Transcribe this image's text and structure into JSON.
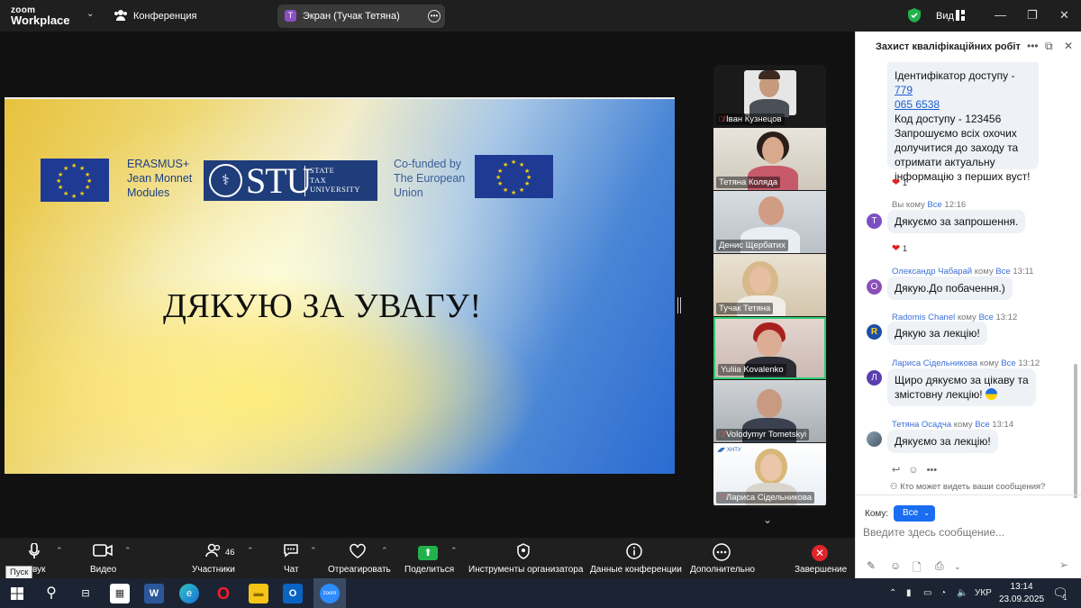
{
  "topbar": {
    "logo_top": "zoom",
    "logo_bottom": "Workplace",
    "conference_label": "Конференция",
    "share_badge": "T",
    "share_title": "Экран (Тучак Тетяна)",
    "view_label": "Вид"
  },
  "slide": {
    "erasmus_line1": "ERASMUS+",
    "erasmus_line2": "Jean Monnet",
    "erasmus_line3": "Modules",
    "stu_big": "STU",
    "stu_small_1": "STATE",
    "stu_small_2": "TAX",
    "stu_small_3": "UNIVERSITY",
    "cofunded_1": "Co-funded by",
    "cofunded_2": "The European",
    "cofunded_3": "Union",
    "title": "ДЯКУЮ ЗА УВАГУ!"
  },
  "participants": [
    {
      "name": "Іван Кузнецов",
      "muted": true
    },
    {
      "name": "Тетяна Коляда",
      "muted": false
    },
    {
      "name": "Денис Щербатих",
      "muted": false
    },
    {
      "name": "Тучак Тетяна",
      "muted": false
    },
    {
      "name": "Yuliia Kovalenko",
      "muted": false
    },
    {
      "name": "Volodymyr Tometskyi",
      "muted": true
    },
    {
      "name": "Лариса Сідельникова",
      "muted": true
    }
  ],
  "chat": {
    "title": "Захист кваліфікаційних робіт",
    "msg0_line_access_id": "Ідентифікатор доступу - ",
    "msg0_id_link_1": "779",
    "msg0_id_link_2": "065 6538",
    "msg0_code": "Код доступу - 123456",
    "msg0_invite_1": "Запрошуємо всіх охочих",
    "msg0_invite_2": "долучитися до заходу та",
    "msg0_invite_3": "отримати актуальну",
    "msg0_invite_4": "інформацію з перших вуст!",
    "reaction_count": "1",
    "messages": [
      {
        "avatar": "T",
        "avatar_color": "#7b4fc4",
        "who": "Вы",
        "to_word": "кому",
        "to": "Все",
        "time": "12:16",
        "text": "Дякуємо за запрошення."
      },
      {
        "avatar": "O",
        "avatar_color": "#8a4fb8",
        "who": "Олександр Чабарай",
        "to_word": "кому",
        "to": "Все",
        "time": "13:11",
        "text": "Дякую.До побачення.)"
      },
      {
        "avatar": "R",
        "avatar_color": "#1d4fa8",
        "who": "Radomis Chanel",
        "to_word": "кому",
        "to": "Все",
        "time": "13:12",
        "text": "Дякую за лекцію!"
      },
      {
        "avatar": "Л",
        "avatar_color": "#5a3fb0",
        "who": "Лариса Сідельникова",
        "to_word": "кому",
        "to": "Все",
        "time": "13:12",
        "text_1": "Щиро дякуємо за цікаву та",
        "text_2": "змістовну лекцію!"
      },
      {
        "avatar": "",
        "avatar_color": "#6a7a88",
        "who": "Тетяна Осадча",
        "to_word": "кому",
        "to": "Все",
        "time": "13:14",
        "text": "Дякуємо за лекцію!"
      }
    ],
    "privacy_note": "Кто может видеть ваши сообщения?",
    "to_label": "Кому:",
    "to_value": "Все",
    "input_placeholder": "Введите здесь сообщение..."
  },
  "toolbar": {
    "audio": "Звук",
    "video": "Видео",
    "participants": "Участники",
    "participants_count": "46",
    "chat": "Чат",
    "react": "Отреагировать",
    "share": "Поделиться",
    "host_tools": "Инструменты организатора",
    "meeting_info": "Данные конференции",
    "more": "Дополнительно",
    "end": "Завершение",
    "start_tooltip": "Пуск"
  },
  "taskbar": {
    "language": "УКР",
    "time": "13:14",
    "date": "23.09.2025",
    "notification_count": "1"
  }
}
